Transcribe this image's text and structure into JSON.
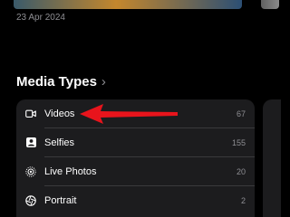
{
  "recent": {
    "date": "23 Apr 2024"
  },
  "media_types": {
    "title": "Media Types",
    "chevron": "›",
    "items": [
      {
        "label": "Videos",
        "count": "67",
        "icon": "video-camera-icon"
      },
      {
        "label": "Selfies",
        "count": "155",
        "icon": "person-square-icon"
      },
      {
        "label": "Live Photos",
        "count": "20",
        "icon": "live-photo-icon"
      },
      {
        "label": "Portrait",
        "count": "2",
        "icon": "aperture-icon"
      }
    ]
  },
  "colors": {
    "background": "#000000",
    "panel": "#1c1c1e",
    "secondary_text": "#8e8e93",
    "annotation_arrow": "#e8141c"
  }
}
